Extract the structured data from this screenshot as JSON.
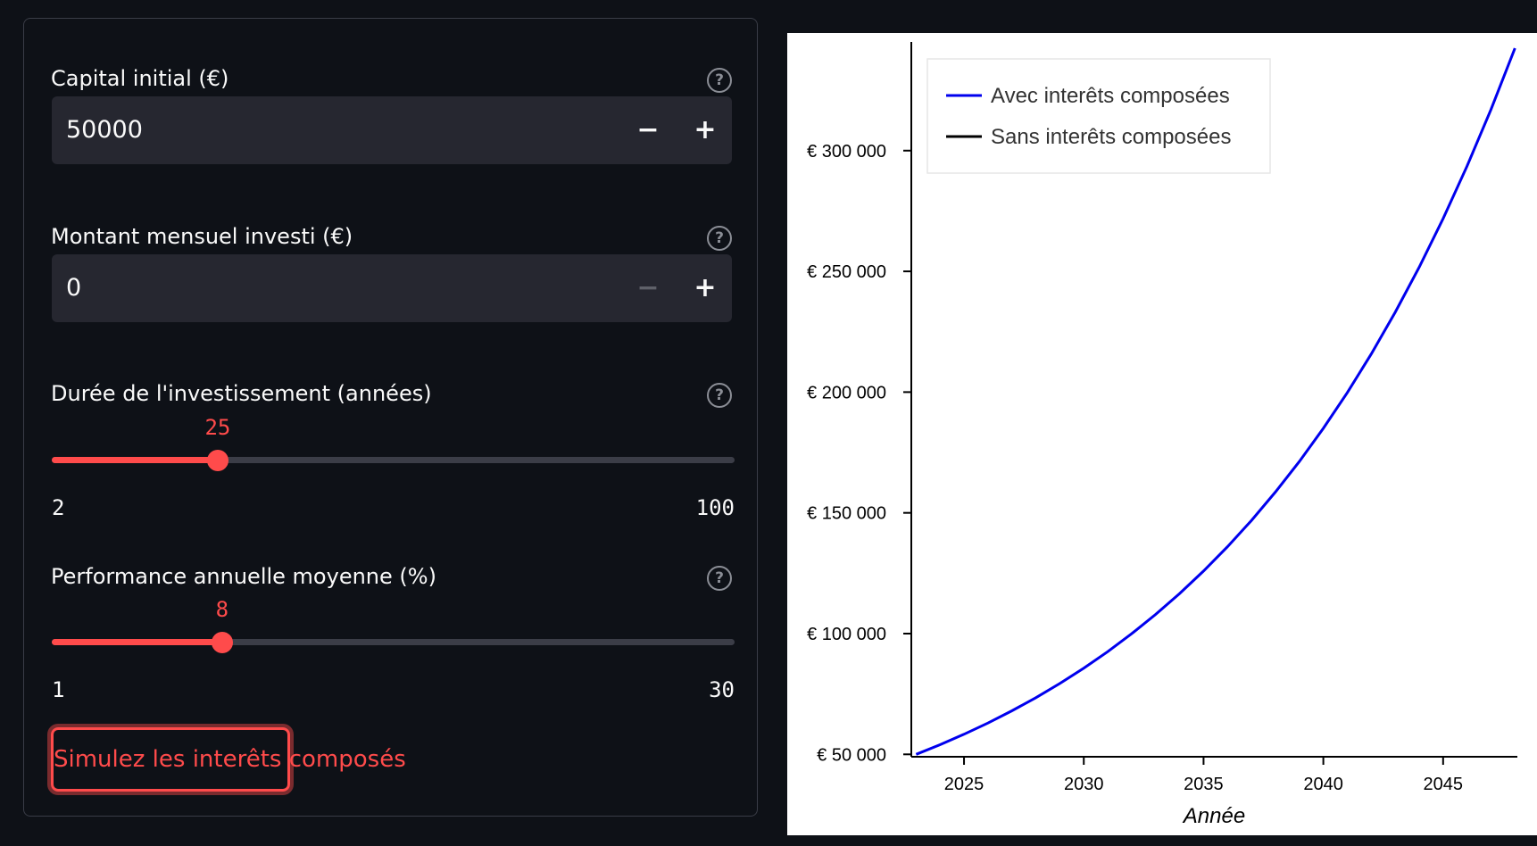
{
  "form": {
    "capital": {
      "label": "Capital initial (€)",
      "value": "50000",
      "help_icon": "question-circle-icon",
      "minus": "−",
      "plus": "+"
    },
    "monthly": {
      "label": "Montant mensuel investi (€)",
      "value": "0",
      "help_icon": "question-circle-icon",
      "minus": "−",
      "plus": "+"
    },
    "duration": {
      "label": "Durée de l'investissement (années)",
      "value": 25,
      "min": 2,
      "max": 100,
      "help_icon": "question-circle-icon"
    },
    "performance": {
      "label": "Performance annuelle moyenne (%)",
      "value": 8,
      "min": 1,
      "max": 30,
      "help_icon": "question-circle-icon"
    },
    "submit_label": "Simulez les interêts composés"
  },
  "colors": {
    "accent": "#ff4b4b",
    "background": "#0e1117",
    "input_bg": "#262730",
    "with_compound": "#0000ee",
    "without_compound": "#000000"
  },
  "chart_data": {
    "type": "line",
    "title": "",
    "xlabel": "Année",
    "ylabel": "",
    "xlim": [
      2022.8,
      2048.1
    ],
    "ylim": [
      49000,
      345000
    ],
    "x_ticks": [
      2025,
      2030,
      2035,
      2040,
      2045
    ],
    "y_ticks": [
      50000,
      100000,
      150000,
      200000,
      250000,
      300000
    ],
    "y_tick_labels": [
      "€ 50 000",
      "€ 100 000",
      "€ 150 000",
      "€ 200 000",
      "€ 250 000",
      "€ 300 000"
    ],
    "legend_position": "top-left",
    "series": [
      {
        "name": "Avec interêts composées",
        "color": "#0000ee",
        "x": [
          2023,
          2024,
          2025,
          2026,
          2027,
          2028,
          2029,
          2030,
          2031,
          2032,
          2033,
          2034,
          2035,
          2036,
          2037,
          2038,
          2039,
          2040,
          2041,
          2042,
          2043,
          2044,
          2045,
          2046,
          2047,
          2048
        ],
        "y": [
          50000,
          54000,
          58320,
          62986,
          68024,
          73466,
          79344,
          85691,
          92547,
          99950,
          107946,
          116582,
          125909,
          135981,
          146860,
          158608,
          171297,
          185001,
          199801,
          215785,
          233048,
          251692,
          271827,
          293574,
          317060,
          342424
        ]
      },
      {
        "name": "Sans interêts composées",
        "color": "#000000",
        "x": [],
        "y": []
      }
    ]
  }
}
